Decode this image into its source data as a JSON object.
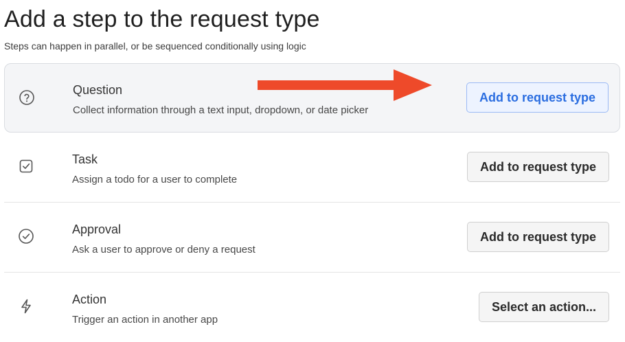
{
  "header": {
    "title": "Add a step to the request type",
    "subtitle": "Steps can happen in parallel, or be sequenced conditionally using logic"
  },
  "steps": [
    {
      "icon": "question-circle-icon",
      "title": "Question",
      "description": "Collect information through a text input, dropdown, or date picker",
      "button_label": "Add to request type",
      "highlighted": true
    },
    {
      "icon": "checkbox-icon",
      "title": "Task",
      "description": "Assign a todo for a user to complete",
      "button_label": "Add to request type",
      "highlighted": false
    },
    {
      "icon": "check-circle-icon",
      "title": "Approval",
      "description": "Ask a user to approve or deny a request",
      "button_label": "Add to request type",
      "highlighted": false
    },
    {
      "icon": "lightning-bolt-icon",
      "title": "Action",
      "description": "Trigger an action in another app",
      "button_label": "Select an action...",
      "highlighted": false
    }
  ],
  "colors": {
    "accent": "#2a6de0",
    "highlight_bg": "#f4f5f7",
    "annotation_arrow": "#ee4a2a"
  }
}
